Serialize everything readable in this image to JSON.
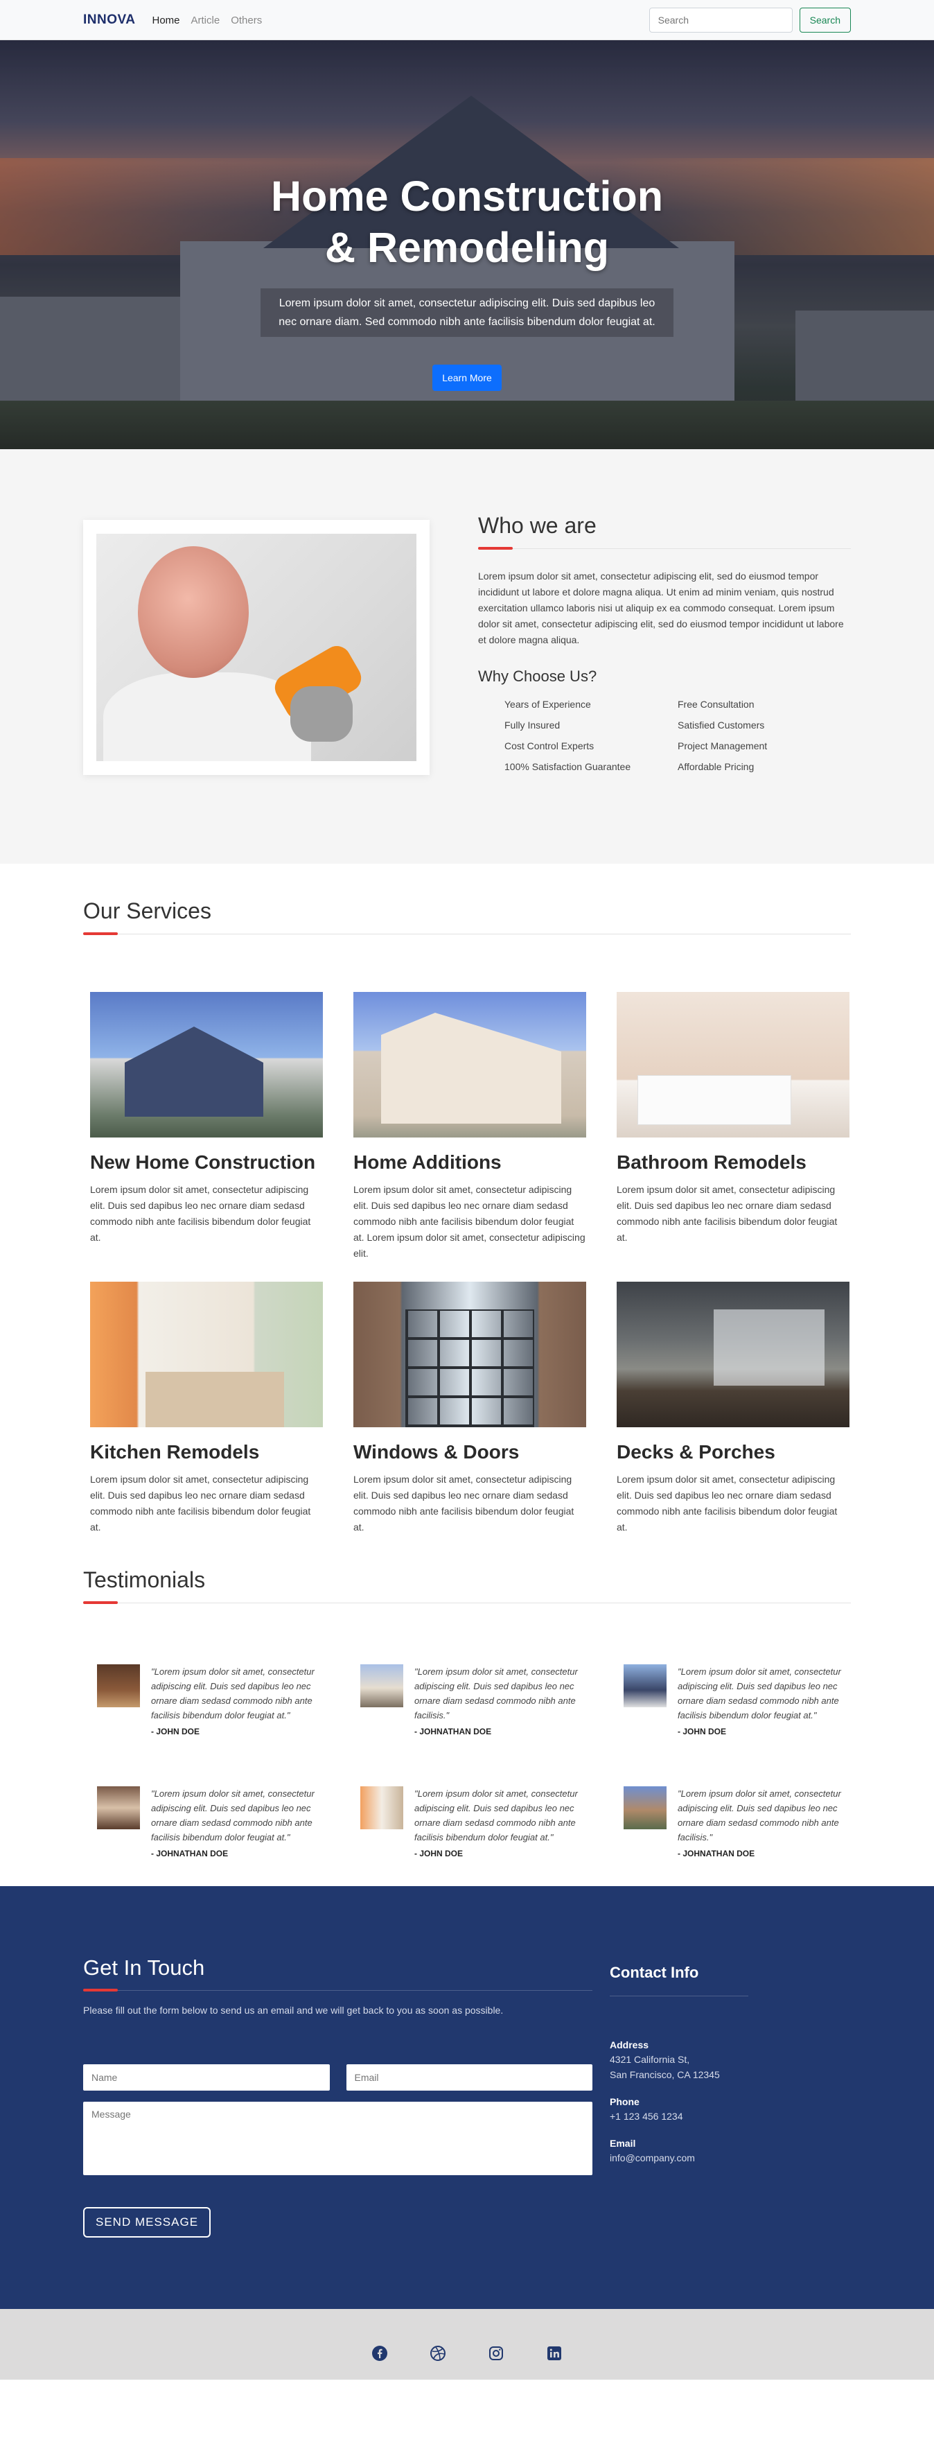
{
  "nav": {
    "brand": "INNOVA",
    "links": [
      "Home",
      "Article",
      "Others"
    ],
    "search_placeholder": "Search",
    "search_button": "Search"
  },
  "hero": {
    "title_line1": "Home Construction",
    "title_line2": "& Remodeling",
    "text": "Lorem ipsum dolor sit amet, consectetur adipiscing elit. Duis sed dapibus leo nec ornare diam. Sed commodo nibh ante facilisis bibendum dolor feugiat at.",
    "button": "Learn More"
  },
  "about": {
    "title": "Who we are",
    "text": "Lorem ipsum dolor sit amet, consectetur adipiscing elit, sed do eiusmod tempor incididunt ut labore et dolore magna aliqua. Ut enim ad minim veniam, quis nostrud exercitation ullamco laboris nisi ut aliquip ex ea commodo consequat. Lorem ipsum dolor sit amet, consectetur adipiscing elit, sed do eiusmod tempor incididunt ut labore et dolore magna aliqua.",
    "why_title": "Why Choose Us?",
    "why_items": [
      "Years of Experience",
      "Free Consultation",
      "Fully Insured",
      "Satisfied Customers",
      "Cost Control Experts",
      "Project Management",
      "100% Satisfaction Guarantee",
      "Affordable Pricing"
    ]
  },
  "services": {
    "title": "Our Services",
    "items": [
      {
        "name": "New Home Construction",
        "desc": "Lorem ipsum dolor sit amet, consectetur adipiscing elit. Duis sed dapibus leo nec ornare diam sedasd commodo nibh ante facilisis bibendum dolor feugiat at."
      },
      {
        "name": "Home Additions",
        "desc": "Lorem ipsum dolor sit amet, consectetur adipiscing elit. Duis sed dapibus leo nec ornare diam sedasd commodo nibh ante facilisis bibendum dolor feugiat at. Lorem ipsum dolor sit amet, consectetur adipiscing elit."
      },
      {
        "name": "Bathroom Remodels",
        "desc": "Lorem ipsum dolor sit amet, consectetur adipiscing elit. Duis sed dapibus leo nec ornare diam sedasd commodo nibh ante facilisis bibendum dolor feugiat at."
      },
      {
        "name": "Kitchen Remodels",
        "desc": "Lorem ipsum dolor sit amet, consectetur adipiscing elit. Duis sed dapibus leo nec ornare diam sedasd commodo nibh ante facilisis bibendum dolor feugiat at."
      },
      {
        "name": "Windows & Doors",
        "desc": "Lorem ipsum dolor sit amet, consectetur adipiscing elit. Duis sed dapibus leo nec ornare diam sedasd commodo nibh ante facilisis bibendum dolor feugiat at."
      },
      {
        "name": "Decks & Porches",
        "desc": "Lorem ipsum dolor sit amet, consectetur adipiscing elit. Duis sed dapibus leo nec ornare diam sedasd commodo nibh ante facilisis bibendum dolor feugiat at."
      }
    ]
  },
  "testimonials": {
    "title": "Testimonials",
    "items": [
      {
        "quote": "\"Lorem ipsum dolor sit amet, consectetur adipiscing elit. Duis sed dapibus leo nec ornare diam sedasd commodo nibh ante facilisis bibendum dolor feugiat at.\"",
        "author": "- JOHN DOE"
      },
      {
        "quote": "\"Lorem ipsum dolor sit amet, consectetur adipiscing elit. Duis sed dapibus leo nec ornare diam sedasd commodo nibh ante facilisis.\"",
        "author": "- JOHNATHAN DOE"
      },
      {
        "quote": "\"Lorem ipsum dolor sit amet, consectetur adipiscing elit. Duis sed dapibus leo nec ornare diam sedasd commodo nibh ante facilisis bibendum dolor feugiat at.\"",
        "author": "- JOHN DOE"
      },
      {
        "quote": "\"Lorem ipsum dolor sit amet, consectetur adipiscing elit. Duis sed dapibus leo nec ornare diam sedasd commodo nibh ante facilisis bibendum dolor feugiat at.\"",
        "author": "- JOHNATHAN DOE"
      },
      {
        "quote": "\"Lorem ipsum dolor sit amet, consectetur adipiscing elit. Duis sed dapibus leo nec ornare diam sedasd commodo nibh ante facilisis bibendum dolor feugiat at.\"",
        "author": "- JOHN DOE"
      },
      {
        "quote": "\"Lorem ipsum dolor sit amet, consectetur adipiscing elit. Duis sed dapibus leo nec ornare diam sedasd commodo nibh ante facilisis.\"",
        "author": "- JOHNATHAN DOE"
      }
    ]
  },
  "contact": {
    "title": "Get In Touch",
    "subtitle": "Please fill out the form below to send us an email and we will get back to you as soon as possible.",
    "name_placeholder": "Name",
    "email_placeholder": "Email",
    "message_placeholder": "Message",
    "send_button": "SEND MESSAGE",
    "info_title": "Contact Info",
    "address_label": "Address",
    "address_line1": "4321 California St,",
    "address_line2": "San Francisco, CA 12345",
    "phone_label": "Phone",
    "phone": "+1 123 456 1234",
    "email_label": "Email",
    "email": "info@company.com"
  },
  "footer": {
    "icons": [
      "facebook-icon",
      "dribbble-icon",
      "instagram-icon",
      "linkedin-icon"
    ],
    "icon_color": "#21386e"
  },
  "colors": {
    "brand": "#1e2f6b",
    "accent_red": "#e53935",
    "primary_button": "#0d6efd",
    "contact_bg": "#21386e",
    "search_button": "#198754"
  }
}
